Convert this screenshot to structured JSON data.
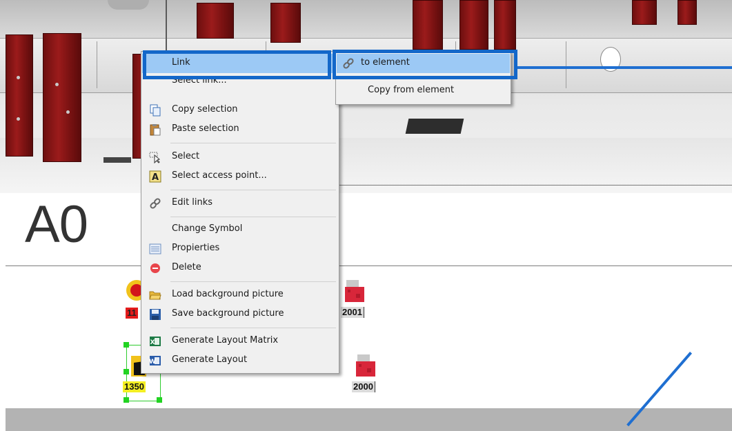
{
  "canvas": {
    "area_label": "A0",
    "devices": [
      {
        "id": "11",
        "tag": "11",
        "icon": "emergency-stop-icon",
        "tag_color": "#e41b1b"
      },
      {
        "id": "2001",
        "tag": "2001",
        "icon": "contactor-icon",
        "tag_color": "#dcdcdc"
      },
      {
        "id": "1350",
        "tag": "1350",
        "icon": "motor-icon",
        "tag_color": "#f4ef23"
      },
      {
        "id": "2000",
        "tag": "2000",
        "icon": "contactor-icon",
        "tag_color": "#dcdcdc"
      }
    ]
  },
  "context_menu": {
    "items": [
      {
        "label": "Link",
        "icon": "",
        "highlighted": true,
        "has_submenu": true
      },
      {
        "label": "Select link...",
        "icon": ""
      },
      {
        "label": "Copy selection",
        "icon": "copy-icon"
      },
      {
        "label": "Paste selection",
        "icon": "paste-icon"
      },
      {
        "label": "Select",
        "icon": "select-icon"
      },
      {
        "label": "Select access point...",
        "icon": "access-point-icon"
      },
      {
        "label": "Edit links",
        "icon": "link-chain-icon"
      },
      {
        "label": "Change Symbol",
        "icon": ""
      },
      {
        "label": "Propierties",
        "icon": "properties-icon"
      },
      {
        "label": "Delete",
        "icon": "delete-icon"
      },
      {
        "label": "Load background picture",
        "icon": "folder-open-icon"
      },
      {
        "label": "Save background picture",
        "icon": "save-icon"
      },
      {
        "label": "Generate Layout Matrix",
        "icon": "excel-icon"
      },
      {
        "label": "Generate Layout",
        "icon": "word-icon"
      }
    ]
  },
  "submenu": {
    "items": [
      {
        "label": "to element",
        "icon": "link-chain-icon",
        "highlighted": true
      },
      {
        "label": "Copy from element",
        "icon": ""
      }
    ]
  },
  "colors": {
    "menu_highlight": "#9cc9f5",
    "annotation_blue": "#1367c9",
    "selection_green": "#22d322"
  }
}
